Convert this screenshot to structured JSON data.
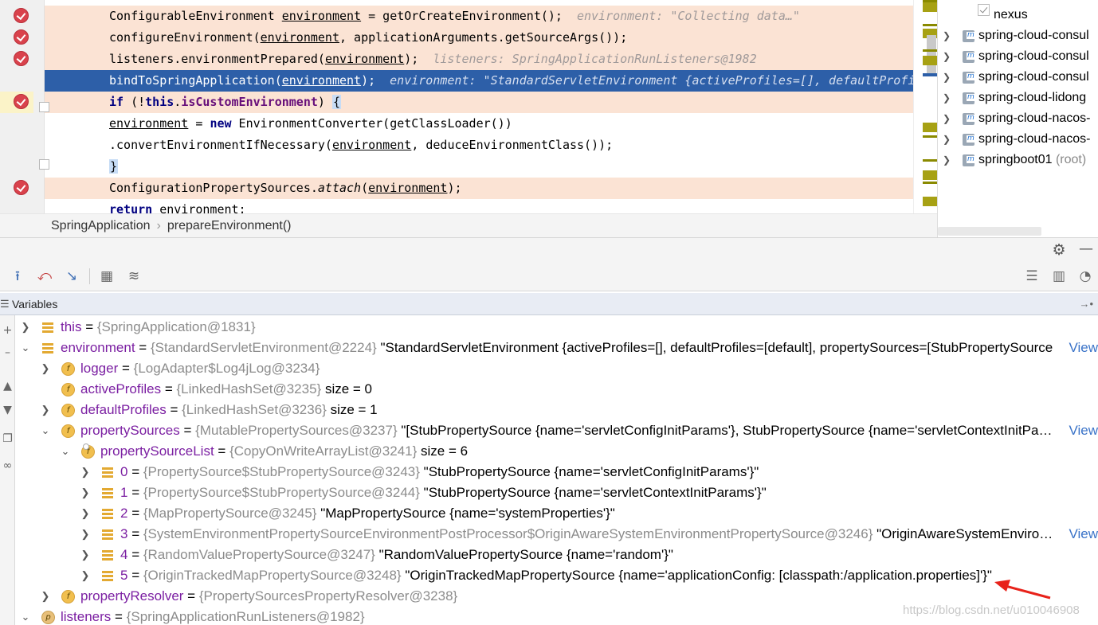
{
  "editor": {
    "lines": [
      {
        "segments": [
          [
            "ConfigurableEnvironment ",
            ""
          ],
          [
            "environment",
            "ident"
          ],
          [
            " = getOrCreateEnvironment();",
            ""
          ]
        ],
        "hint": "environment: \"Collecting data…\"",
        "kind": "bp"
      },
      {
        "segments": [
          [
            "configureEnvironment(",
            ""
          ],
          [
            "environment",
            "ident"
          ],
          [
            ", applicationArguments.getSourceArgs());",
            ""
          ]
        ],
        "hint": "",
        "kind": "bp"
      },
      {
        "segments": [
          [
            "listeners.environmentPrepared(",
            ""
          ],
          [
            "environment",
            "ident"
          ],
          [
            ");",
            ""
          ]
        ],
        "hint": "listeners: SpringApplicationRunListeners@1982",
        "kind": "bp"
      },
      {
        "segments": [
          [
            "bindToSpringApplication(",
            ""
          ],
          [
            "environment",
            "ident"
          ],
          [
            ");",
            ""
          ]
        ],
        "hint": "environment: \"StandardServletEnvironment {activeProfiles=[], defaultProfiles",
        "kind": "sel"
      },
      {
        "segments": [
          [
            "if",
            "kw"
          ],
          [
            " (!",
            ""
          ],
          [
            "this",
            "kw"
          ],
          [
            ".",
            ""
          ],
          [
            "isCustomEnvironment",
            "field"
          ],
          [
            ") ",
            ""
          ],
          [
            "{",
            "bracket"
          ]
        ],
        "hint": "",
        "kind": "bp"
      },
      {
        "segments": [
          [
            "    ",
            ""
          ],
          [
            "environment",
            "ident"
          ],
          [
            " = ",
            ""
          ],
          [
            "new",
            "kw"
          ],
          [
            " EnvironmentConverter(getClassLoader())",
            ""
          ]
        ],
        "hint": "",
        "kind": ""
      },
      {
        "segments": [
          [
            "            .convertEnvironmentIfNecessary(",
            ""
          ],
          [
            "environment",
            "ident"
          ],
          [
            ", deduceEnvironmentClass());",
            ""
          ]
        ],
        "hint": "",
        "kind": ""
      },
      {
        "segments": [
          [
            "}",
            "bracket"
          ]
        ],
        "hint": "",
        "kind": ""
      },
      {
        "segments": [
          [
            "ConfigurationPropertySources.",
            ""
          ],
          [
            "attach",
            "it"
          ],
          [
            "(",
            ""
          ],
          [
            "environment",
            "ident"
          ],
          [
            ");",
            ""
          ]
        ],
        "hint": "",
        "kind": "bp"
      },
      {
        "segments": [
          [
            "return",
            "kw"
          ],
          [
            " environment;",
            ""
          ]
        ],
        "hint": "",
        "kind": ""
      }
    ]
  },
  "breadcrumb": {
    "class_name": "SpringApplication",
    "method_name": "prepareEnvironment()"
  },
  "project_tree": {
    "items": [
      {
        "label": "nexus",
        "type": "checkbox"
      },
      {
        "label": "spring-cloud-consul",
        "type": "module"
      },
      {
        "label": "spring-cloud-consul",
        "type": "module"
      },
      {
        "label": "spring-cloud-consul",
        "type": "module"
      },
      {
        "label": "spring-cloud-lidong",
        "type": "module"
      },
      {
        "label": "spring-cloud-nacos-",
        "type": "module"
      },
      {
        "label": "spring-cloud-nacos-",
        "type": "module"
      },
      {
        "label": "springboot01",
        "type": "module",
        "suffix": "(root)"
      }
    ]
  },
  "debug_toolbar": {
    "icons": [
      "show-execution-point-icon",
      "drop-frame-icon",
      "force-step-into-icon",
      "evaluate-expression-icon",
      "trace-current-stream-icon"
    ]
  },
  "variables": {
    "title": "Variables",
    "view_label": "View",
    "rows": [
      {
        "indent": 0,
        "chev": "collapsed",
        "icon": "bars",
        "name": "this",
        "ref": "{SpringApplication@1831}",
        "value": "",
        "view": false
      },
      {
        "indent": 0,
        "chev": "expanded",
        "icon": "bars",
        "name": "environment",
        "ref": "{StandardServletEnvironment@2224}",
        "value": "\"StandardServletEnvironment {activeProfiles=[], defaultProfiles=[default], propertySources=[StubPropertySource",
        "view": true
      },
      {
        "indent": 1,
        "chev": "collapsed",
        "icon": "field",
        "name": "logger",
        "ref": "{LogAdapter$Log4jLog@3234}",
        "value": "",
        "view": false
      },
      {
        "indent": 1,
        "chev": "none",
        "icon": "field",
        "name": "activeProfiles",
        "ref": "{LinkedHashSet@3235}",
        "value": "size = 0",
        "view": false
      },
      {
        "indent": 1,
        "chev": "collapsed",
        "icon": "field",
        "name": "defaultProfiles",
        "ref": "{LinkedHashSet@3236}",
        "value": "size = 1",
        "view": false
      },
      {
        "indent": 1,
        "chev": "expanded",
        "icon": "field",
        "name": "propertySources",
        "ref": "{MutablePropertySources@3237}",
        "value": "\"[StubPropertySource {name='servletConfigInitParams'}, StubPropertySource {name='servletContextInitParam",
        "view": true
      },
      {
        "indent": 2,
        "chev": "expanded",
        "icon": "field-final",
        "name": "propertySourceList",
        "ref": "{CopyOnWriteArrayList@3241}",
        "value": "size = 6",
        "view": false
      },
      {
        "indent": 3,
        "chev": "collapsed",
        "icon": "bars",
        "name": "0",
        "ref": "{PropertySource$StubPropertySource@3243}",
        "value": "\"StubPropertySource {name='servletConfigInitParams'}\"",
        "view": false
      },
      {
        "indent": 3,
        "chev": "collapsed",
        "icon": "bars",
        "name": "1",
        "ref": "{PropertySource$StubPropertySource@3244}",
        "value": "\"StubPropertySource {name='servletContextInitParams'}\"",
        "view": false
      },
      {
        "indent": 3,
        "chev": "collapsed",
        "icon": "bars",
        "name": "2",
        "ref": "{MapPropertySource@3245}",
        "value": "\"MapPropertySource {name='systemProperties'}\"",
        "view": false
      },
      {
        "indent": 3,
        "chev": "collapsed",
        "icon": "bars",
        "name": "3",
        "ref": "{SystemEnvironmentPropertySourceEnvironmentPostProcessor$OriginAwareSystemEnvironmentPropertySource@3246}",
        "value": "\"OriginAwareSystemEnvironme",
        "view": true
      },
      {
        "indent": 3,
        "chev": "collapsed",
        "icon": "bars",
        "name": "4",
        "ref": "{RandomValuePropertySource@3247}",
        "value": "\"RandomValuePropertySource {name='random'}\"",
        "view": false
      },
      {
        "indent": 3,
        "chev": "collapsed",
        "icon": "bars",
        "name": "5",
        "ref": "{OriginTrackedMapPropertySource@3248}",
        "value": "\"OriginTrackedMapPropertySource {name='applicationConfig: [classpath:/application.properties]'}\"",
        "view": false
      },
      {
        "indent": 1,
        "chev": "collapsed",
        "icon": "field",
        "name": "propertyResolver",
        "ref": "{PropertySourcesPropertyResolver@3238}",
        "value": "",
        "view": false
      },
      {
        "indent": 0,
        "chev": "expanded",
        "icon": "param",
        "name": "listeners",
        "ref": "{SpringApplicationRunListeners@1982}",
        "value": "",
        "view": false
      }
    ]
  },
  "watermark": "https://blog.csdn.net/u010046908",
  "colors": {
    "selection": "#2d5fa8",
    "breakpoint_line": "#fbe3d4",
    "breakpoint_icon": "#d9424c",
    "field_name": "#7b1fa2",
    "ref_gray": "#8c8c8c",
    "arrow_red": "#e8221a"
  }
}
